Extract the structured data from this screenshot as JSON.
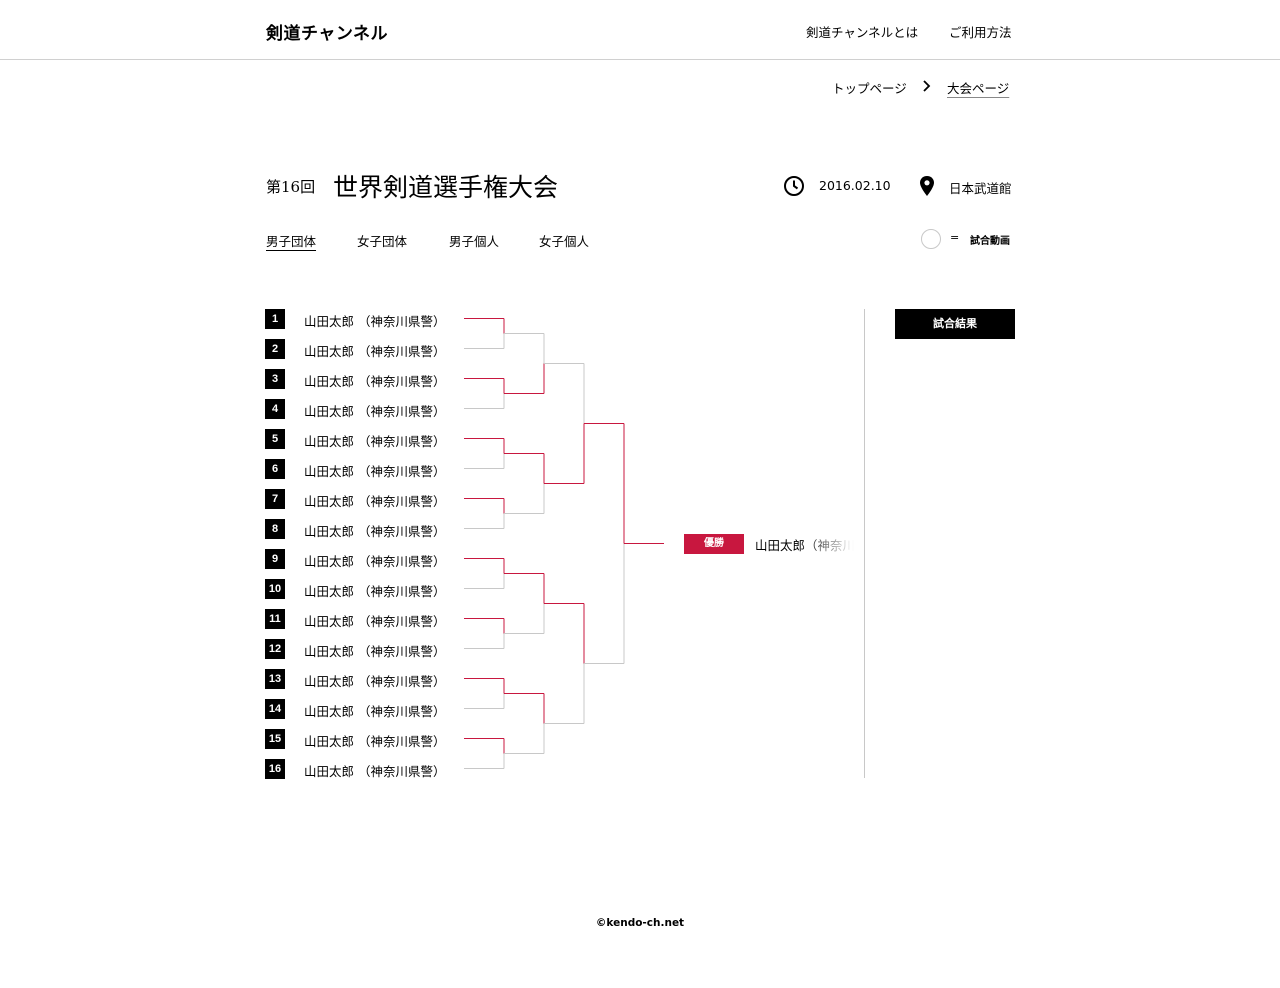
{
  "header": {
    "logo": "剣道チャンネル",
    "nav": [
      "剣道チャンネルとは",
      "ご利用方法"
    ]
  },
  "breadcrumb": {
    "home": "トップページ",
    "current": "大会ページ"
  },
  "tournament": {
    "number": "第16回",
    "name": "世界剣道選手権大会",
    "date": "2016.02.10",
    "venue": "日本武道館"
  },
  "tabs": [
    "男子団体",
    "女子団体",
    "男子個人",
    "女子個人"
  ],
  "legend": {
    "equals": "=",
    "label": "試合動画"
  },
  "bracket": {
    "entries": [
      {
        "seed": "1",
        "name": "山田太郎 （神奈川県警）"
      },
      {
        "seed": "2",
        "name": "山田太郎 （神奈川県警）"
      },
      {
        "seed": "3",
        "name": "山田太郎 （神奈川県警）"
      },
      {
        "seed": "4",
        "name": "山田太郎 （神奈川県警）"
      },
      {
        "seed": "5",
        "name": "山田太郎 （神奈川県警）"
      },
      {
        "seed": "6",
        "name": "山田太郎 （神奈川県警）"
      },
      {
        "seed": "7",
        "name": "山田太郎 （神奈川県警）"
      },
      {
        "seed": "8",
        "name": "山田太郎 （神奈川県警）"
      },
      {
        "seed": "9",
        "name": "山田太郎 （神奈川県警）"
      },
      {
        "seed": "10",
        "name": "山田太郎 （神奈川県警）"
      },
      {
        "seed": "11",
        "name": "山田太郎 （神奈川県警）"
      },
      {
        "seed": "12",
        "name": "山田太郎 （神奈川県警）"
      },
      {
        "seed": "13",
        "name": "山田太郎 （神奈川県警）"
      },
      {
        "seed": "14",
        "name": "山田太郎 （神奈川県警）"
      },
      {
        "seed": "15",
        "name": "山田太郎 （神奈川県警）"
      },
      {
        "seed": "16",
        "name": "山田太郎 （神奈川県警）"
      }
    ],
    "winners": {
      "round1": [
        0,
        0,
        0,
        0,
        0,
        0,
        0,
        0
      ],
      "round2": [
        1,
        0,
        0,
        0
      ],
      "round3": [
        1,
        0
      ],
      "final": [
        0
      ]
    },
    "champion": {
      "badge": "優勝",
      "name": "山田太郎（神奈川県警）"
    }
  },
  "results_button": "試合結果",
  "colors": {
    "accent": "#c8173f",
    "line": "#c8c8c8"
  },
  "footer": "©kendo-ch.net"
}
